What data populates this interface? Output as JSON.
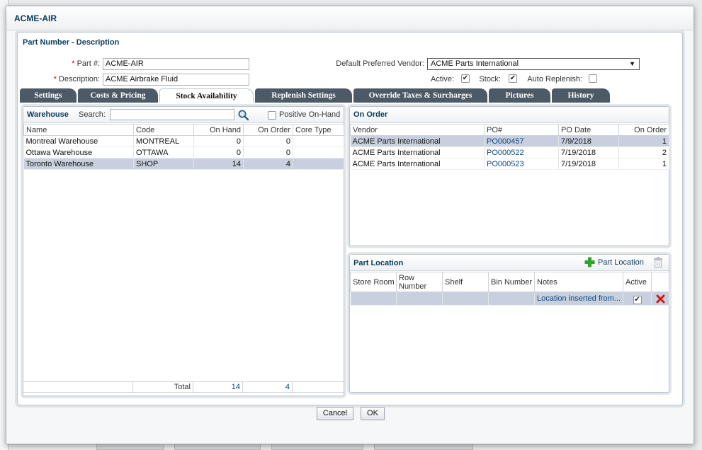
{
  "dialog": {
    "title": "ACME-AIR",
    "panel_title": "Part Number - Description"
  },
  "form": {
    "part_label": "Part #:",
    "part_value": "ACME-AIR",
    "description_label": "Description:",
    "description_value": "ACME Airbrake Fluid",
    "vendor_label": "Default Preferred Vendor:",
    "vendor_value": "ACME Parts International",
    "active_label": "Active:",
    "active_checked": "✔",
    "stock_label": "Stock:",
    "stock_checked": "✔",
    "auto_replenish_label": "Auto Replenish:",
    "required_marker": "*"
  },
  "tabs": [
    {
      "label": "Settings"
    },
    {
      "label": "Costs & Pricing"
    },
    {
      "label": "Stock Availability"
    },
    {
      "label": "Replenish Settings"
    },
    {
      "label": "Override Taxes & Surcharges"
    },
    {
      "label": "Pictures"
    },
    {
      "label": "History"
    }
  ],
  "warehouse": {
    "title": "Warehouse",
    "search_label": "Search:",
    "search_value": "",
    "positive_label": "Positive On-Hand",
    "columns": [
      "Name",
      "Code",
      "On Hand",
      "On Order",
      "Core Type"
    ],
    "rows": [
      {
        "name": "Montreal Warehouse",
        "code": "MONTREAL",
        "on_hand": "0",
        "on_order": "0",
        "core": ""
      },
      {
        "name": "Ottawa Warehouse",
        "code": "OTTAWA",
        "on_hand": "0",
        "on_order": "0",
        "core": ""
      },
      {
        "name": "Toronto Warehouse",
        "code": "SHOP",
        "on_hand": "14",
        "on_order": "4",
        "core": ""
      }
    ],
    "total_label": "Total",
    "total_on_hand": "14",
    "total_on_order": "4"
  },
  "on_order": {
    "title": "On Order",
    "columns": [
      "Vendor",
      "PO#",
      "PO Date",
      "On Order"
    ],
    "rows": [
      {
        "vendor": "ACME Parts International",
        "po": "PO000457",
        "date": "7/9/2018",
        "qty": "1"
      },
      {
        "vendor": "ACME Parts International",
        "po": "PO000522",
        "date": "7/19/2018",
        "qty": "2"
      },
      {
        "vendor": "ACME Parts International",
        "po": "PO000523",
        "date": "7/19/2018",
        "qty": "1"
      }
    ]
  },
  "part_location": {
    "title": "Part Location",
    "add_label": "Part Location",
    "columns": [
      "Store Room",
      "Row Number",
      "Shelf",
      "Bin Number",
      "Notes",
      "Active"
    ],
    "row": {
      "notes": "Location inserted from...",
      "active": "✔"
    }
  },
  "buttons": {
    "cancel": "Cancel",
    "ok": "OK"
  },
  "colors": {
    "accent": "#0a3a5c",
    "tab_bg": "#4c5966",
    "selected_row": "#c8d0df",
    "delete": "#d11a1a",
    "add": "#2fa52f"
  }
}
